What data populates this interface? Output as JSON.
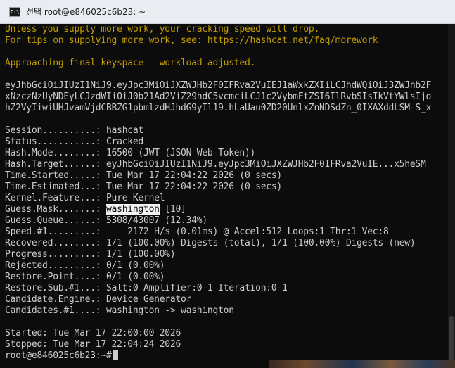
{
  "window": {
    "icon_label": "C:\\",
    "title": "선택 root@e846025c6b23: ~"
  },
  "terminal": {
    "notice_lines": [
      "Unless you supply more work, your cracking speed will drop.",
      "For tips on supplying more work, see: https://hashcat.net/faq/morework"
    ],
    "approach_line": "Approaching final keyspace - workload adjusted.",
    "jwt_lines": [
      "eyJhbGciOiJIUzI1NiJ9.eyJpc3MiOiJXZWJHb2F0IFRva2VuIEJ1aWxkZXIiLCJhdWQiOiJ3ZWJnb2F",
      "xNzczNzUyNDEyLCJzdWIiOiJ0b21Ad2ViZ29hdC5vcmciLCJ1c2VybmFtZSI6IlRvbSIsIkVtYWlsIjo",
      "hZ2VyIiwiUHJvamVjdCBBZG1pbmlzdHJhdG9yIl19.hLaUau0ZD20UnlxZnNDSdZn_0IXAXddLSM-S_x"
    ],
    "status": [
      {
        "label": "Session..........: ",
        "value": "hashcat"
      },
      {
        "label": "Status...........: ",
        "value": "Cracked"
      },
      {
        "label": "Hash.Mode........: ",
        "value": "16500 (JWT (JSON Web Token))"
      },
      {
        "label": "Hash.Target......: ",
        "value": "eyJhbGciOiJIUzI1NiJ9.eyJpc3MiOiJXZWJHb2F0IFRva2VuIE...x5heSM"
      },
      {
        "label": "Time.Started.....: ",
        "value": "Tue Mar 17 22:04:22 2026 (0 secs)"
      },
      {
        "label": "Time.Estimated...: ",
        "value": "Tue Mar 17 22:04:22 2026 (0 secs)"
      },
      {
        "label": "Kernel.Feature...: ",
        "value": "Pure Kernel"
      }
    ],
    "guess_mask": {
      "label": "Guess.Mask.......: ",
      "value": "washington",
      "suffix": " [10]"
    },
    "status2": [
      {
        "label": "Guess.Queue......: ",
        "value": "5308/43007 (12.34%)"
      },
      {
        "label": "Speed.#1.........: ",
        "value": "    2172 H/s (0.01ms) @ Accel:512 Loops:1 Thr:1 Vec:8"
      },
      {
        "label": "Recovered........: ",
        "value": "1/1 (100.00%) Digests (total), 1/1 (100.00%) Digests (new)"
      },
      {
        "label": "Progress.........: ",
        "value": "1/1 (100.00%)"
      },
      {
        "label": "Rejected.........: ",
        "value": "0/1 (0.00%)"
      },
      {
        "label": "Restore.Point....: ",
        "value": "0/1 (0.00%)"
      },
      {
        "label": "Restore.Sub.#1...: ",
        "value": "Salt:0 Amplifier:0-1 Iteration:0-1"
      },
      {
        "label": "Candidate.Engine.: ",
        "value": "Device Generator"
      },
      {
        "label": "Candidates.#1....: ",
        "value": "washington -> washington"
      }
    ],
    "started": "Started: Tue Mar 17 22:00:00 2026",
    "stopped": "Stopped: Tue Mar 17 22:04:24 2026",
    "prompt": "root@e846025c6b23:~#"
  }
}
